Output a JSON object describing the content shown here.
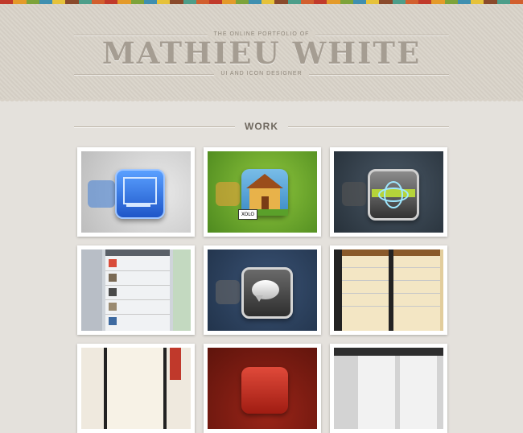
{
  "header": {
    "kicker": "THE ONLINE PORTFOLIO OF",
    "name": "MATHIEU WHITE",
    "role": "UI AND ICON DESIGNER"
  },
  "section": {
    "title": "WORK"
  },
  "colors": {
    "stripe": [
      "#c13a2b",
      "#e49a2a",
      "#7da33a",
      "#3f8fb0",
      "#e6c23a",
      "#8a4a2b",
      "#4d9e8a",
      "#d25f2e"
    ],
    "header_bg": "#d8d2c8",
    "page_bg": "#e4e1dc",
    "name_text": "#a59d92"
  },
  "thumbnails": [
    {
      "name": "blueprint-icon",
      "bg": "#c9c9c9"
    },
    {
      "name": "house-icon",
      "bg": "#6aa32a"
    },
    {
      "name": "atom-icon",
      "bg": "#2e3a44"
    },
    {
      "name": "twitter-client-screens",
      "bg": "#d9dde2"
    },
    {
      "name": "speech-bubble-icon",
      "bg": "#2a3b52"
    },
    {
      "name": "tasks-app-screens",
      "bg": "#e6d2a6"
    },
    {
      "name": "dictionary-app-screens",
      "bg": "#e9e4da"
    },
    {
      "name": "red-app-icon",
      "bg": "#7a1a12"
    },
    {
      "name": "app-screens",
      "bg": "#d7d7d7"
    }
  ]
}
